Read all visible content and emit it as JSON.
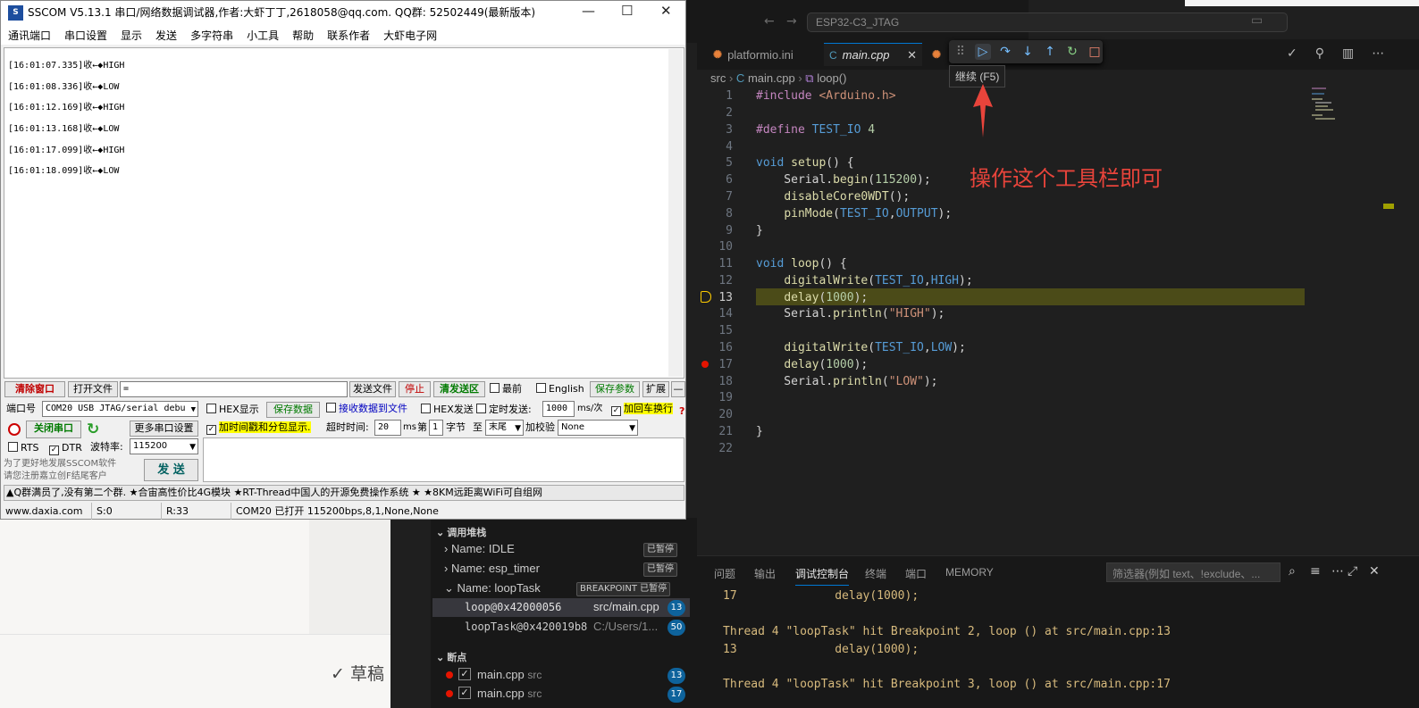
{
  "sscom": {
    "title": "SSCOM V5.13.1 串口/网络数据调试器,作者:大虾丁丁,2618058@qq.com. QQ群: 52502449(最新版本)",
    "menu": [
      "通讯端口",
      "串口设置",
      "显示",
      "发送",
      "多字符串",
      "小工具",
      "帮助",
      "联系作者",
      "大虾电子网"
    ],
    "receive_lines": [
      "[16:01:07.335]收←◆HIGH",
      "[16:01:08.336]收←◆LOW",
      "[16:01:12.169]收←◆HIGH",
      "[16:01:13.168]收←◆LOW",
      "[16:01:17.099]收←◆HIGH",
      "[16:01:18.099]收←◆LOW"
    ],
    "toolbar": {
      "clear_window": "清除窗口",
      "open_file": "打开文件",
      "file_path": "=",
      "send_file": "发送文件",
      "stop": "停止",
      "clear_send": "清发送区",
      "topmost": "最前",
      "english": "English",
      "save_params": "保存参数",
      "expand": "扩展",
      "collapse": "—"
    },
    "port_label": "端口号",
    "port_value": "COM20 USB JTAG/serial debu",
    "hex_display": "HEX显示",
    "save_data": "保存数据",
    "recv_to_file": "接收数据到文件",
    "hex_send": "HEX发送",
    "timed_send": "定时发送:",
    "interval": "1000",
    "interval_unit": "ms/次",
    "add_crlf": "加回车换行",
    "close_port": "关闭串口",
    "more_settings": "更多串口设置",
    "add_timestamp": "加时间戳和分包显示.",
    "timeout_label": "超时时间:",
    "timeout_value": "20",
    "ms": "ms",
    "di": "第",
    "byte_from": "1",
    "byte_label": "字节",
    "to_label": "至",
    "tail": "末尾",
    "checksum_label": "加校验",
    "checksum_value": "None",
    "rts": "RTS",
    "dtr": "DTR",
    "baud_label": "波特率:",
    "baud_value": "115200",
    "promo1": "为了更好地发展SSCOM软件",
    "promo2": "请您注册嘉立创F结尾客户",
    "send_btn": "发  送",
    "question": "?",
    "ad": "▲Q群满员了,没有第二个群. ★合宙高性价比4G模块 ★RT-Thread中国人的开源免费操作系统 ★ ★8KM远距离WiFi可自组网",
    "status": {
      "site": "www.daxia.com",
      "s": "S:0",
      "r": "R:33",
      "port": "COM20 已打开  115200bps,8,1,None,None"
    }
  },
  "background": {
    "draft": "✓ 草稿"
  },
  "vscode": {
    "search": "ESP32-C3_JTAG",
    "tabs": [
      {
        "label": "platformio.ini",
        "icon": "platformio-icon"
      },
      {
        "label": "main.cpp",
        "icon": "cpp-icon",
        "active": true
      }
    ],
    "tooltip": "继续 (F5)",
    "annotation": "操作这个工具栏即可",
    "breadcrumb": [
      "src",
      "main.cpp",
      "loop()"
    ],
    "code_lines": [
      "1",
      "2",
      "3",
      "4",
      "5",
      "6",
      "7",
      "8",
      "9",
      "10",
      "11",
      "12",
      "13",
      "14",
      "15",
      "16",
      "17",
      "18",
      "19",
      "20",
      "21",
      "22"
    ],
    "panel_tabs": [
      "问题",
      "输出",
      "调试控制台",
      "终端",
      "端口",
      "MEMORY"
    ],
    "panel_filter": "筛选器(例如 text、!exclude、...",
    "console": [
      {
        "text": "17              delay(1000);",
        "kind": "orange"
      },
      {
        "text": "",
        "kind": "w"
      },
      {
        "text": "Thread 4 \"loopTask\" hit Breakpoint 2, loop () at src/main.cpp:13",
        "kind": "orange"
      },
      {
        "text": "13              delay(1000);",
        "kind": "orange"
      },
      {
        "text": "",
        "kind": "w"
      },
      {
        "text": "Thread 4 \"loopTask\" hit Breakpoint 3, loop () at src/main.cpp:17",
        "kind": "orange"
      }
    ],
    "callstack": {
      "header": "调用堆栈",
      "threads": [
        {
          "name": "Name: IDLE",
          "badge": "已暂停"
        },
        {
          "name": "Name: esp_timer",
          "badge": "已暂停"
        },
        {
          "name": "Name: loopTask",
          "badge": "BREAKPOINT 已暂停"
        }
      ],
      "frames": [
        {
          "fn": "loop@0x42000056",
          "file": "src/main.cpp",
          "line": "13"
        },
        {
          "fn": "loopTask@0x420019b8",
          "file": "C:/Users/1...",
          "line": "50"
        }
      ]
    },
    "breakpoints": {
      "header": "断点",
      "items": [
        {
          "file": "main.cpp",
          "dir": "src",
          "line": "13"
        },
        {
          "file": "main.cpp",
          "dir": "src",
          "line": "17"
        }
      ]
    }
  },
  "colors": {
    "vscode_bg": "#1f1f1f",
    "highlight": "#4b4b18",
    "accent": "#0078d4",
    "annotation": "#e8443b",
    "breakpoint": "#e51400"
  }
}
